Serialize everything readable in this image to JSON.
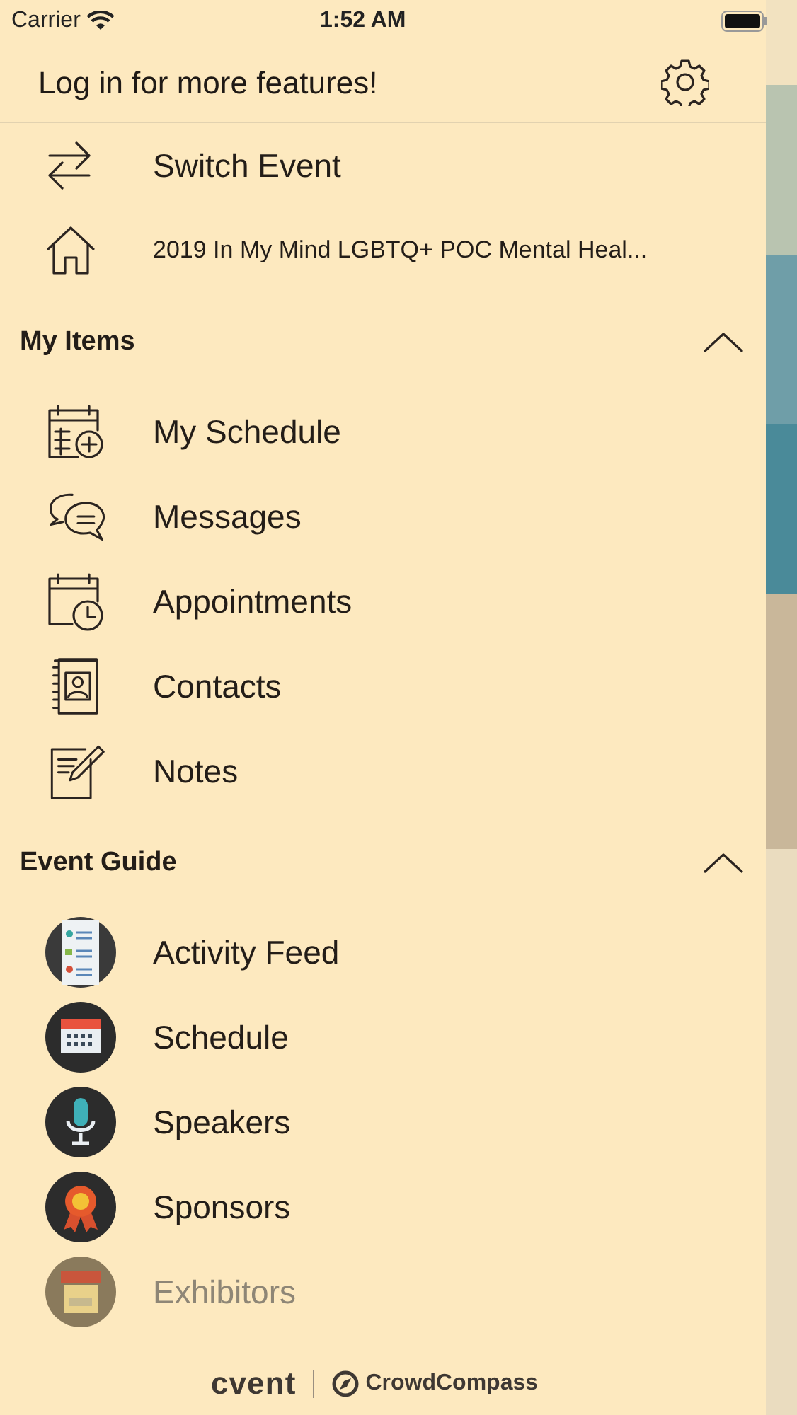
{
  "status_bar": {
    "carrier": "Carrier",
    "time": "1:52 AM"
  },
  "header": {
    "title": "Log in for more features!"
  },
  "top_items": [
    {
      "label": "Switch Event",
      "kind": "large"
    },
    {
      "label": "2019 In My Mind LGBTQ+ POC Mental Heal...",
      "kind": "small"
    }
  ],
  "sections": [
    {
      "title": "My Items",
      "expanded": true,
      "items": [
        {
          "label": "My Schedule",
          "dimmed": false
        },
        {
          "label": "Messages",
          "dimmed": false
        },
        {
          "label": "Appointments",
          "dimmed": false
        },
        {
          "label": "Contacts",
          "dimmed": false
        },
        {
          "label": "Notes",
          "dimmed": false
        }
      ]
    },
    {
      "title": "Event Guide",
      "expanded": true,
      "items": [
        {
          "label": "Activity Feed",
          "dimmed": false
        },
        {
          "label": "Schedule",
          "dimmed": false
        },
        {
          "label": "Speakers",
          "dimmed": false
        },
        {
          "label": "Sponsors",
          "dimmed": false
        },
        {
          "label": "Exhibitors",
          "dimmed": true
        }
      ]
    }
  ],
  "footer": {
    "brand": "cvent",
    "partner": "CrowdCompass"
  }
}
